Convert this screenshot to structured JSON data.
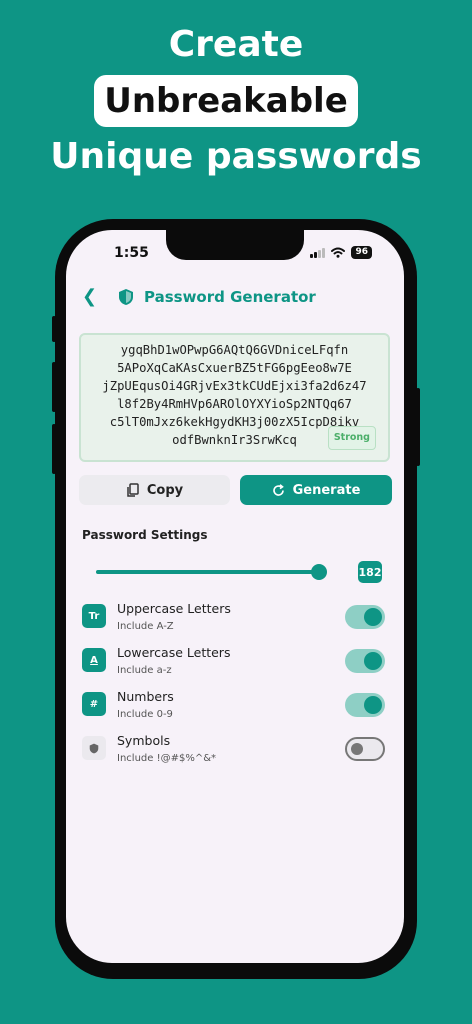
{
  "promo": {
    "line1": "Create",
    "line2": "Unbreakable",
    "line3": "Unique passwords"
  },
  "status": {
    "time": "1:55",
    "battery": "96"
  },
  "appbar": {
    "title": "Password Generator"
  },
  "password": {
    "value": "ygqBhD1wOPwpG6AQtQ6GVDniceLFqfn5APoXqCaKAsCxuerBZ5tFG6pgEeo8w7EjZpUEqusOi4GRjvEx3tkCUdEjxi3fa2d6z47l8f2By4RmHVp6AROlOYXYioSp2NTQq67c5lT0mJxz6kekHgydKH3j00zX5IcpD8ikvodfBwnknIr3SrwKcq",
    "lines": [
      "ygqBhD1wOPwpG6AQtQ6GVDniceLFqfn",
      "5APoXqCaKAsCxuerBZ5tFG6pgEeo8w7E",
      "jZpUEqusOi4GRjvEx3tkCUdEjxi3fa2d6z47",
      "l8f2By4RmHVp6AROlOYXYioSp2NTQq67",
      "c5lT0mJxz6kekHgydKH3j00zX5IcpD8ikv",
      "odfBwnknIr3SrwKcq"
    ],
    "strength": "Strong"
  },
  "actions": {
    "copy": "Copy",
    "generate": "Generate"
  },
  "settings": {
    "heading": "Password Settings",
    "length": 182,
    "length_fraction": 0.97,
    "options": [
      {
        "label": "Uppercase Letters",
        "sub": "Include A-Z",
        "icon": "Tr",
        "icon_name": "uppercase-icon",
        "enabled": true
      },
      {
        "label": "Lowercase Letters",
        "sub": "Include a-z",
        "icon": "A",
        "icon_name": "lowercase-icon",
        "enabled": true
      },
      {
        "label": "Numbers",
        "sub": "Include 0-9",
        "icon": "#",
        "icon_name": "hash-icon",
        "enabled": true
      },
      {
        "label": "Symbols",
        "sub": "Include !@#$%^&*",
        "icon": "",
        "icon_name": "shield-icon",
        "enabled": false
      }
    ]
  },
  "colors": {
    "accent": "#0e9585",
    "background": "#0e9585",
    "screen": "#f7f2f9"
  }
}
